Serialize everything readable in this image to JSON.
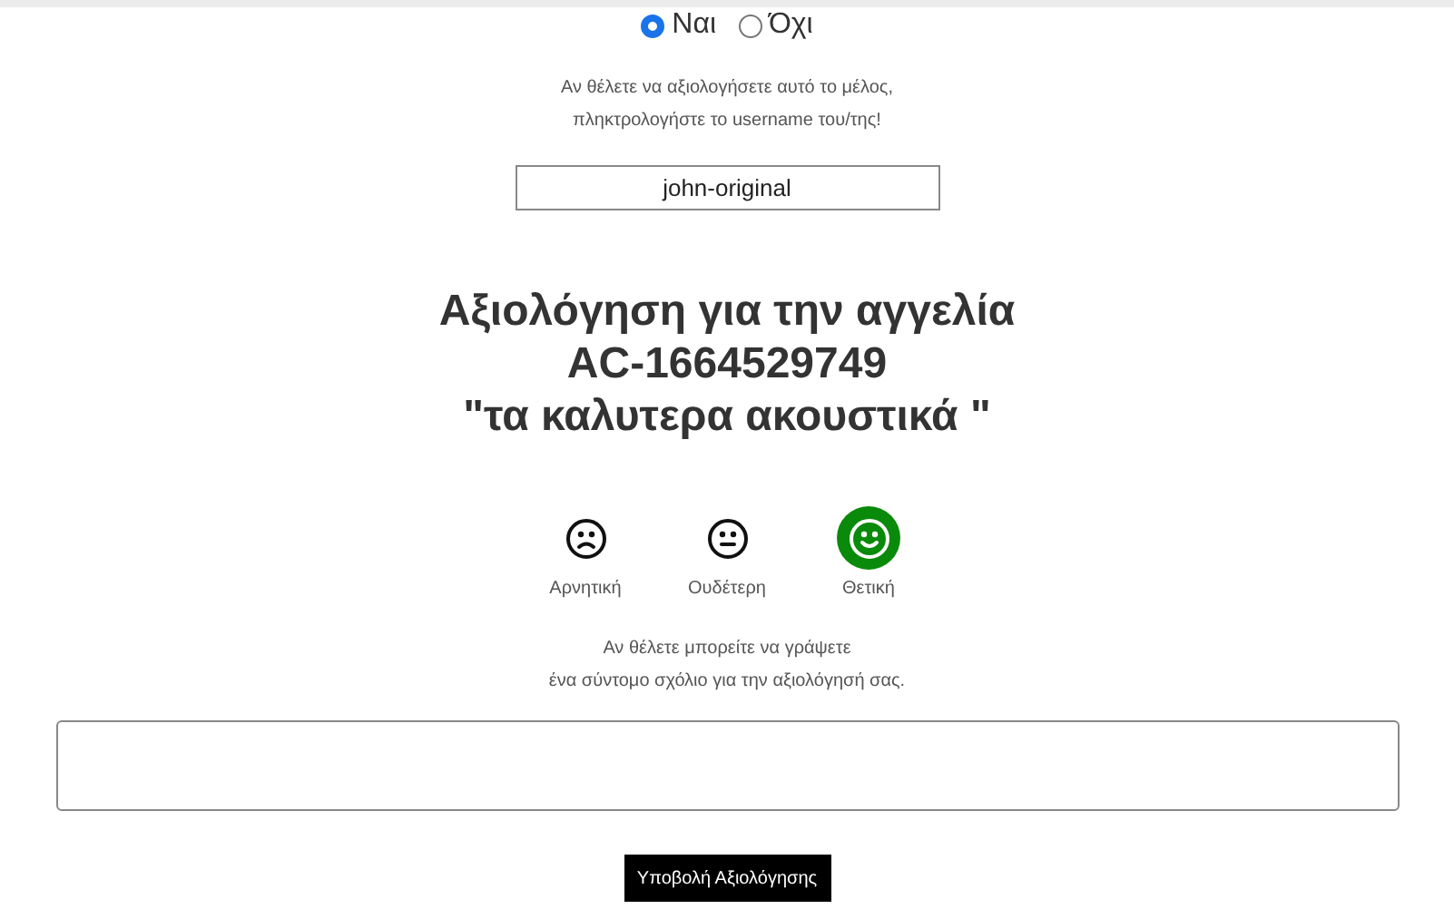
{
  "radios": [
    {
      "label": "Ναι",
      "selected": true
    },
    {
      "label": "Όχι",
      "selected": false
    }
  ],
  "username_hint": [
    "Αν θέλετε να αξιολογήσετε αυτό το μέλος,",
    "πληκτρολογήστε το username του/της!"
  ],
  "username_field": {
    "value": "john-original"
  },
  "heading": [
    "Αξιολόγηση για την αγγελία",
    "AC-1664529749",
    "\"τα καλυτερα ακουστικά \""
  ],
  "ratings": [
    {
      "kind": "negative",
      "label": "Αρνητική",
      "selected": false
    },
    {
      "kind": "neutral",
      "label": "Ουδέτερη",
      "selected": false
    },
    {
      "kind": "positive",
      "label": "Θετική",
      "selected": true
    }
  ],
  "comment_hint": [
    "Αν θέλετε μπορείτε να γράψετε",
    "ένα σύντομο σχόλιο για την αξιολόγησή σας."
  ],
  "submit_button": "Υποβολή Αξιολόγησης"
}
